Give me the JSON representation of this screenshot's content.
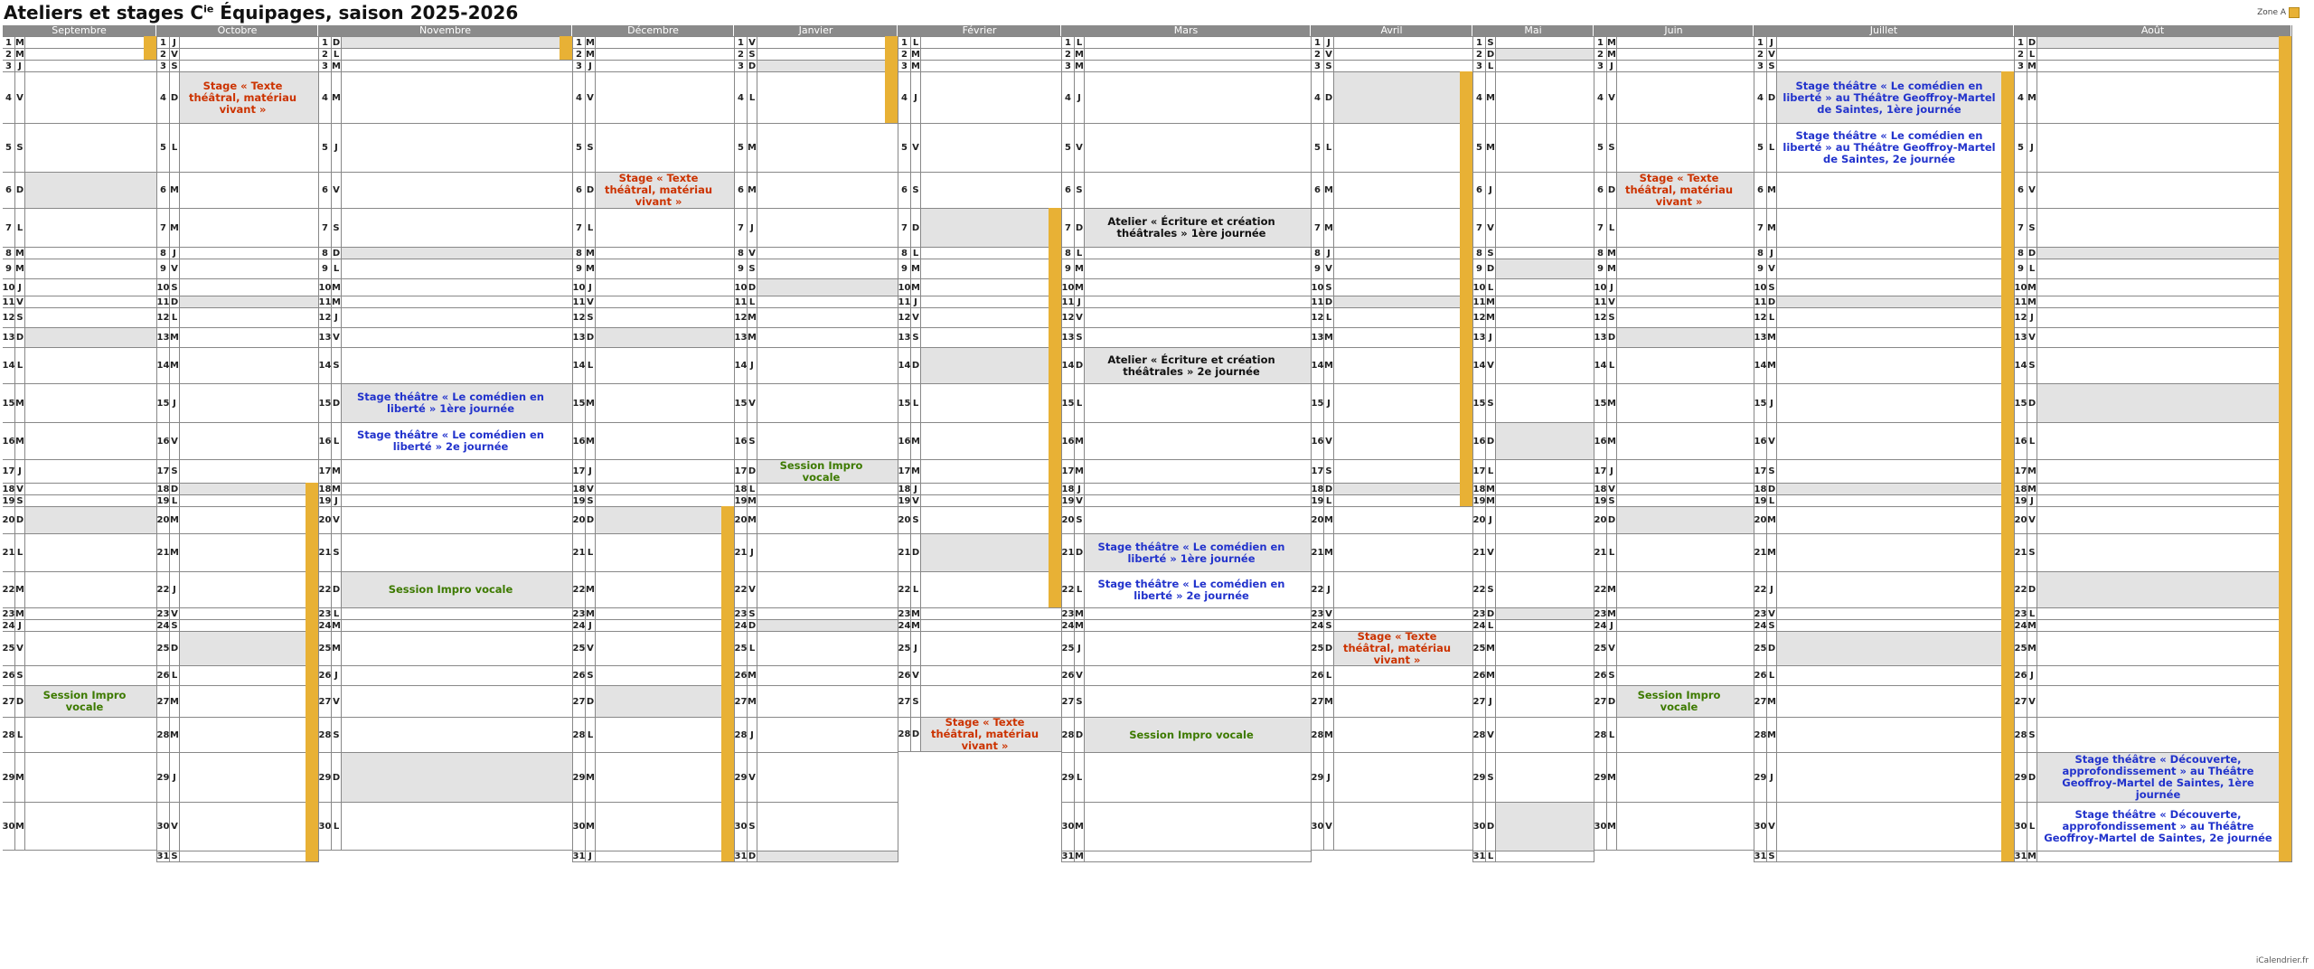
{
  "title": "Ateliers et stages Cie Équipages, saison 2025-2026",
  "title_parts": {
    "pre": "Ateliers et stages C",
    "sup": "ie",
    "post": " Équipages, saison 2025-2026"
  },
  "legend": {
    "zone_label": "Zone A",
    "zone_color": "#E8B135"
  },
  "footer": "iCalendrier.fr",
  "colors": {
    "weekend": "#e3e3e3",
    "zone": "#E8B135",
    "red": "#cc3300",
    "blue": "#2233cc",
    "green": "#3d7a00"
  },
  "months": [
    {
      "name": "Septembre",
      "days": 30,
      "start": 1,
      "zone": [
        [
          1,
          2
        ]
      ],
      "events": [
        {
          "day": 27,
          "text": "Session Impro vocale",
          "color": "green"
        }
      ]
    },
    {
      "name": "Octobre",
      "days": 31,
      "start": 3,
      "zone": [
        [
          18,
          31
        ]
      ],
      "events": [
        {
          "day": 4,
          "text": "Stage « Texte théâtral, matériau vivant »",
          "color": "red"
        }
      ]
    },
    {
      "name": "Novembre",
      "days": 30,
      "start": 6,
      "zone": [
        [
          1,
          2
        ]
      ],
      "events": [
        {
          "day": 15,
          "text": "Stage théâtre « Le comédien en liberté » 1ère journée",
          "color": "blue"
        },
        {
          "day": 16,
          "text": "Stage théâtre « Le comédien en liberté » 2e journée",
          "color": "blue"
        },
        {
          "day": 22,
          "text": "Session Impro vocale",
          "color": "green"
        }
      ]
    },
    {
      "name": "Décembre",
      "days": 31,
      "start": 1,
      "zone": [
        [
          20,
          31
        ]
      ],
      "events": [
        {
          "day": 6,
          "text": "Stage « Texte théâtral, matériau vivant »",
          "color": "red"
        }
      ]
    },
    {
      "name": "Janvier",
      "days": 31,
      "start": 4,
      "zone": [
        [
          1,
          4
        ]
      ],
      "events": [
        {
          "day": 17,
          "text": "Session Impro vocale",
          "color": "green"
        }
      ]
    },
    {
      "name": "Février",
      "days": 28,
      "start": 0,
      "zone": [
        [
          7,
          22
        ]
      ],
      "events": [
        {
          "day": 28,
          "text": "Stage « Texte théâtral, matériau vivant »",
          "color": "red"
        }
      ]
    },
    {
      "name": "Mars",
      "days": 31,
      "start": 0,
      "zone": [],
      "events": [
        {
          "day": 7,
          "text": "Atelier « Écriture et création théâtrales » 1ère journée",
          "color": "black"
        },
        {
          "day": 14,
          "text": "Atelier « Écriture et création théâtrales » 2e journée",
          "color": "black"
        },
        {
          "day": 21,
          "text": "Stage théâtre « Le comédien en liberté » 1ère journée",
          "color": "blue"
        },
        {
          "day": 22,
          "text": "Stage théâtre « Le comédien en liberté » 2e journée",
          "color": "blue"
        },
        {
          "day": 28,
          "text": "Session Impro vocale",
          "color": "green"
        }
      ]
    },
    {
      "name": "Avril",
      "days": 30,
      "start": 3,
      "zone": [
        [
          4,
          19
        ]
      ],
      "events": [
        {
          "day": 25,
          "text": "Stage « Texte théâtral, matériau vivant »",
          "color": "red"
        }
      ]
    },
    {
      "name": "Mai",
      "days": 31,
      "start": 5,
      "zone": [],
      "events": []
    },
    {
      "name": "Juin",
      "days": 30,
      "start": 1,
      "zone": [],
      "events": [
        {
          "day": 6,
          "text": "Stage « Texte théâtral, matériau vivant »",
          "color": "red"
        },
        {
          "day": 27,
          "text": "Session Impro vocale",
          "color": "green"
        }
      ]
    },
    {
      "name": "Juillet",
      "days": 31,
      "start": 3,
      "zone": [
        [
          4,
          31
        ]
      ],
      "events": [
        {
          "day": 4,
          "text": "Stage théâtre « Le comédien en liberté » au Théâtre Geoffroy-Martel de Saintes, 1ère journée",
          "color": "blue"
        },
        {
          "day": 5,
          "text": "Stage théâtre « Le comédien en liberté » au Théâtre Geoffroy-Martel de Saintes, 2e journée",
          "color": "blue"
        }
      ]
    },
    {
      "name": "Août",
      "days": 31,
      "start": 6,
      "zone": [
        [
          1,
          31
        ]
      ],
      "events": [
        {
          "day": 29,
          "text": "Stage théâtre « Découverte, approfondissement » au Théâtre Geoffroy-Martel de Saintes, 1ère journée",
          "color": "blue"
        },
        {
          "day": 30,
          "text": "Stage théâtre « Découverte, approfondissement » au Théâtre Geoffroy-Martel de Saintes, 2e journée",
          "color": "blue"
        }
      ]
    }
  ],
  "weekday_letters": [
    "L",
    "M",
    "M",
    "J",
    "V",
    "S",
    "D"
  ]
}
